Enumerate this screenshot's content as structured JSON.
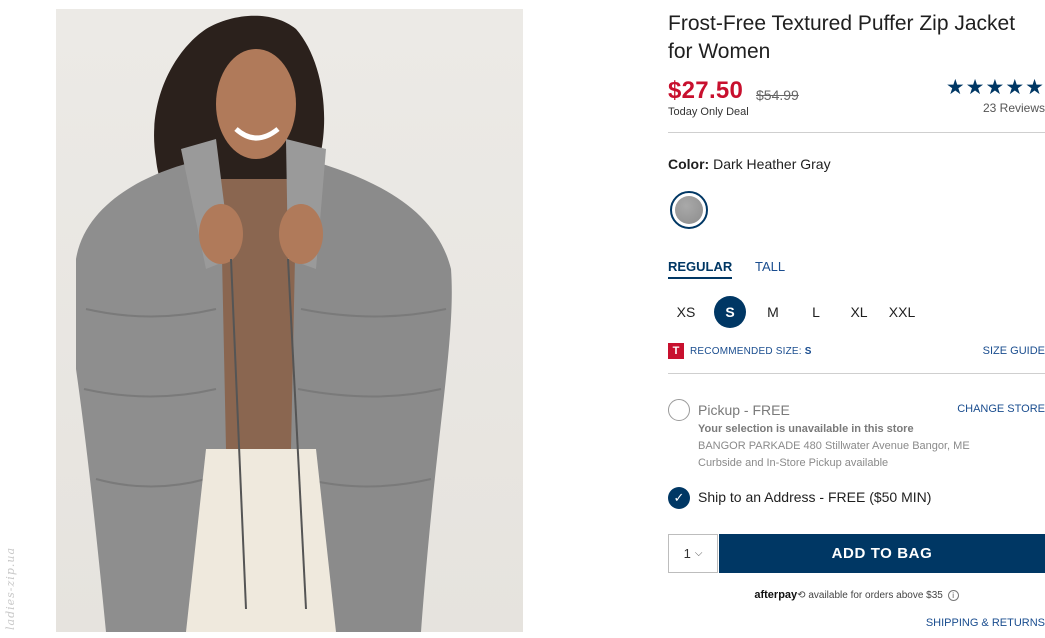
{
  "product": {
    "title": "Frost-Free Textured Puffer Zip Jacket for Women",
    "price": "$27.50",
    "old_price": "$54.99",
    "deal_label": "Today Only Deal",
    "stars": "★★★★★",
    "reviews": "23 Reviews"
  },
  "color": {
    "label": "Color:",
    "value": "Dark Heather Gray",
    "swatch_color": "#9a9a9a"
  },
  "fit": {
    "tabs": [
      {
        "label": "REGULAR",
        "active": true
      },
      {
        "label": "TALL",
        "active": false
      }
    ]
  },
  "sizes": {
    "options": [
      "XS",
      "S",
      "M",
      "L",
      "XL",
      "XXL"
    ],
    "selected": "S"
  },
  "recommended": {
    "icon_letter": "T",
    "label": "RECOMMENDED SIZE:",
    "size": "S",
    "guide_link": "SIZE GUIDE"
  },
  "fulfillment": {
    "pickup_label": "Pickup - FREE",
    "change_store": "CHANGE STORE",
    "unavailable": "Your selection is unavailable in this store",
    "store_address": "BANGOR PARKADE 480 Stillwater Avenue  Bangor, ME",
    "store_note": "Curbside and In-Store Pickup available",
    "ship_label": "Ship to an Address - FREE ($50 MIN)",
    "ship_check": "✓"
  },
  "purchase": {
    "quantity": "1",
    "add_to_bag": "ADD TO BAG"
  },
  "afterpay": {
    "brand": "afterpay",
    "text": "available for orders above $35",
    "info": "i"
  },
  "footer": {
    "shipping_returns": "SHIPPING & RETURNS"
  },
  "watermark": "ladies-zip.ua",
  "colors": {
    "accent": "#003764",
    "sale": "#c8102e",
    "link": "#1a4d8f"
  }
}
